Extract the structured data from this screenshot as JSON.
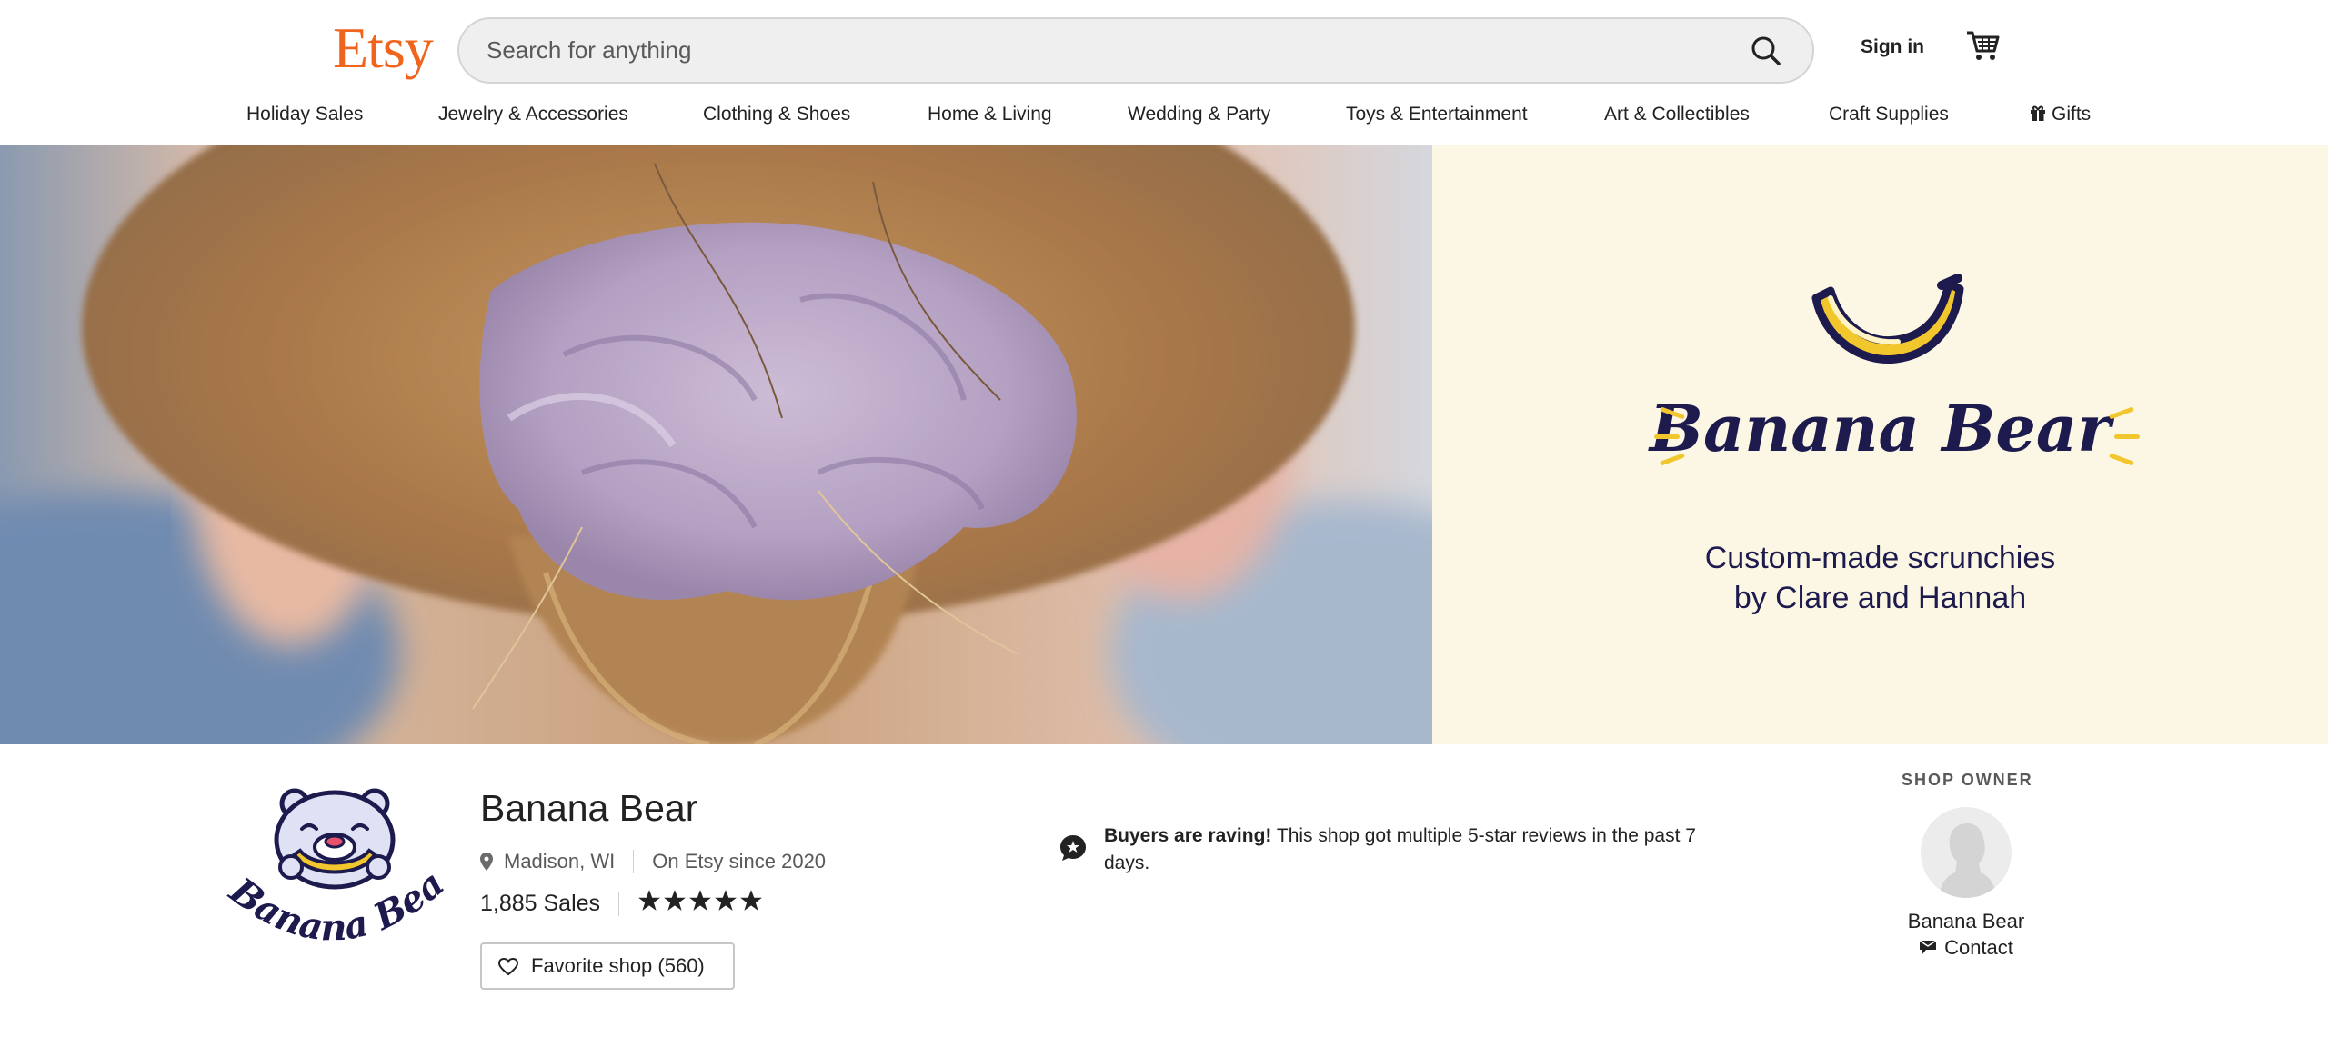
{
  "header": {
    "logo": "Etsy",
    "search_placeholder": "Search for anything",
    "sign_in": "Sign in"
  },
  "categories": [
    {
      "label": "Holiday Sales"
    },
    {
      "label": "Jewelry & Accessories"
    },
    {
      "label": "Clothing & Shoes"
    },
    {
      "label": "Home & Living"
    },
    {
      "label": "Wedding & Party"
    },
    {
      "label": "Toys & Entertainment"
    },
    {
      "label": "Art & Collectibles"
    },
    {
      "label": "Craft Supplies"
    },
    {
      "label": "Gifts",
      "icon": "gift-icon"
    }
  ],
  "banner": {
    "brand_name": "Banana Bear",
    "tagline_line1": "Custom-made scrunchies",
    "tagline_line2": "by Clare and Hannah",
    "colors": {
      "panel_bg": "#fcf7e4",
      "navy": "#1d1a4e",
      "yellow": "#f2c72d"
    }
  },
  "shop": {
    "logo_text": "Banana Bear",
    "name": "Banana Bear",
    "location": "Madison, WI",
    "since": "On Etsy since 2020",
    "sales": "1,885 Sales",
    "rating": 5,
    "favorite_label": "Favorite shop (560)"
  },
  "raving": {
    "bold": "Buyers are raving!",
    "text": " This shop got multiple 5-star reviews in the past 7 days."
  },
  "owner": {
    "label": "SHOP OWNER",
    "name": "Banana Bear",
    "contact": "Contact"
  },
  "colors": {
    "brand": "#F1641E"
  }
}
